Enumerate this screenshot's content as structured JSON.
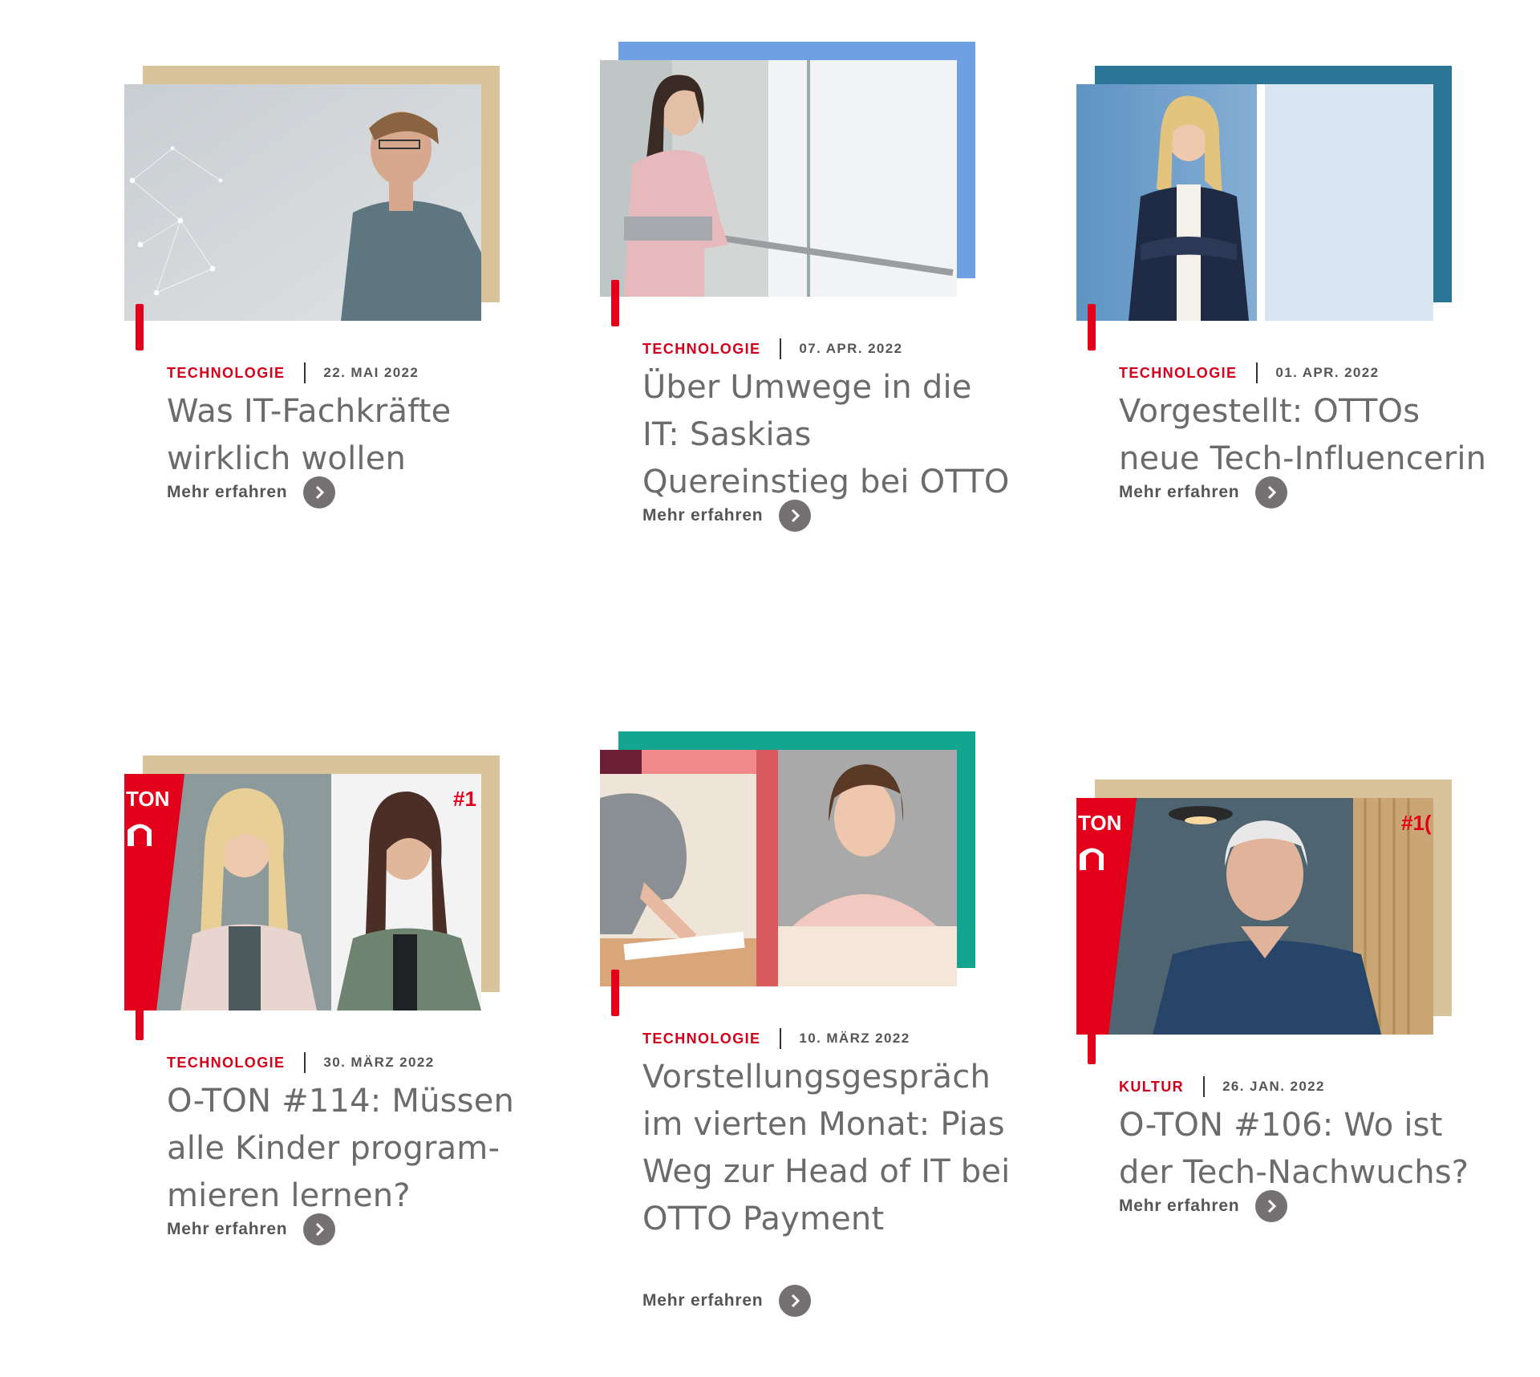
{
  "articles": [
    {
      "category": "TECHNOLOGIE",
      "date": "22. MAI 2022",
      "title": "Was IT-Fachkräfte wirklich wollen",
      "cta": "Mehr erfahren",
      "frame_color": "#d9c39b"
    },
    {
      "category": "TECHNOLOGIE",
      "date": "07. APR. 2022",
      "title": "Über Umwege in die IT: Saskias Quereinstieg bei OTTO",
      "cta": "Mehr erfahren",
      "frame_color": "#6fa0e4"
    },
    {
      "category": "TECHNOLOGIE",
      "date": "01. APR. 2022",
      "title": "Vorgestellt: OTTOs neue Tech-Influencerin",
      "cta": "Mehr erfahren",
      "frame_color": "#2a7496"
    },
    {
      "category": "TECHNOLOGIE",
      "date": "30. MÄRZ 2022",
      "title": "O-TON #114: Müssen alle Kinder program-mieren lernen?",
      "cta": "Mehr erfahren",
      "frame_color": "#d9c39b",
      "badge": "TON",
      "badge_number": "#1"
    },
    {
      "category": "TECHNOLOGIE",
      "date": "10. MÄRZ 2022",
      "title": "Vorstellungsgespräch im vierten Monat: Pias Weg zur Head of IT bei OTTO Payment",
      "cta": "Mehr erfahren",
      "frame_color": "#12a590"
    },
    {
      "category": "KULTUR",
      "date": "26. JAN. 2022",
      "title": "O-TON #106: Wo ist der Tech-Nachwuchs?",
      "cta": "Mehr erfahren",
      "frame_color": "#d9c39b",
      "badge": "TON",
      "badge_number": "#1("
    }
  ],
  "icons": {
    "cta": "chevron-right-icon"
  },
  "colors": {
    "accent_red": "#e3001b",
    "text": "#6b6b6b"
  }
}
